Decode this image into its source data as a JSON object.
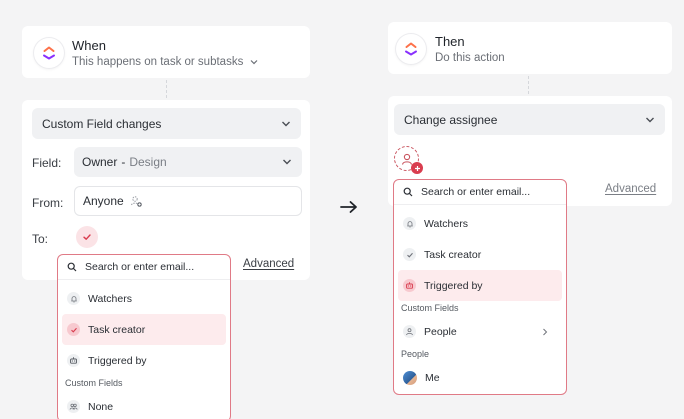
{
  "colors": {
    "accent": "#d93d4f",
    "dropdown_border": "#e07a86",
    "selected_bg": "#fdebed",
    "page_bg": "#f4f4f5"
  },
  "trigger": {
    "title": "When",
    "subtitle": "This happens on task or subtasks",
    "event_select": "Custom Field changes",
    "field_label": "Field:",
    "field_value": "Owner",
    "field_separator": "-",
    "field_list": "Design",
    "from_label": "From:",
    "from_value": "Anyone",
    "to_label": "To:",
    "advanced": "Advanced",
    "dropdown": {
      "search_placeholder": "Search or enter email...",
      "items": [
        {
          "label": "Watchers",
          "icon": "bell-icon",
          "selected": false
        },
        {
          "label": "Task creator",
          "icon": "check-icon",
          "selected": true
        },
        {
          "label": "Triggered by",
          "icon": "robot-icon",
          "selected": false
        }
      ],
      "section_custom_fields": "Custom Fields",
      "custom_items": [
        {
          "label": "None",
          "icon": "users-icon"
        }
      ]
    }
  },
  "action": {
    "title": "Then",
    "subtitle": "Do this action",
    "action_select": "Change assignee",
    "advanced": "Advanced",
    "dropdown": {
      "search_placeholder": "Search or enter email...",
      "items": [
        {
          "label": "Watchers",
          "icon": "bell-icon",
          "selected": false
        },
        {
          "label": "Task creator",
          "icon": "check-icon",
          "selected": false
        },
        {
          "label": "Triggered by",
          "icon": "robot-icon",
          "selected": true
        }
      ],
      "section_custom_fields": "Custom Fields",
      "custom_items": [
        {
          "label": "People",
          "icon": "user-icon"
        }
      ],
      "section_people": "People",
      "people": [
        {
          "label": "Me"
        }
      ]
    }
  },
  "connector_arrow": "→"
}
